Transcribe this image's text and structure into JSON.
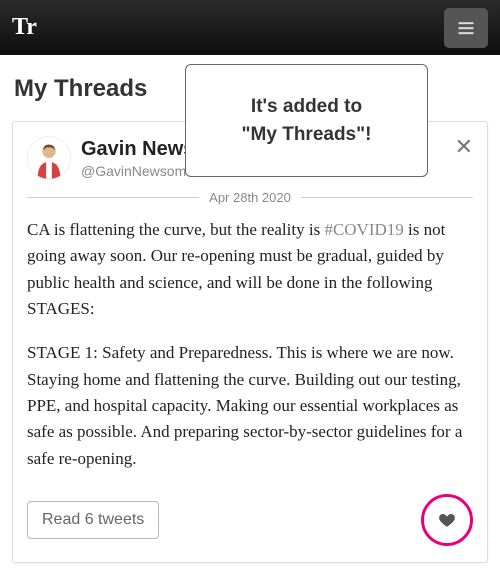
{
  "brand": "Tr",
  "page_title": "My Threads",
  "tooltip": {
    "line1": "It's added to",
    "line2": "\"My Threads\"!"
  },
  "thread": {
    "display_name": "Gavin News",
    "handle": "@GavinNewsom",
    "date": "Apr 28th 2020",
    "hashtag": "#COVID19",
    "para1_before": "CA is flattening the curve, but the reality is ",
    "para1_after": " is not going away soon. Our re-opening must be gradual, guided by public health and science, and will be done in the following STAGES:",
    "para2": "STAGE 1: Safety and Preparedness. This is where we are now. Staying home and flattening the curve. Building out our testing, PPE, and hospital capacity. Making our essential workplaces as safe as possible. And preparing sector-by-sector guidelines for a safe re-opening.",
    "read_button": "Read 6 tweets"
  }
}
